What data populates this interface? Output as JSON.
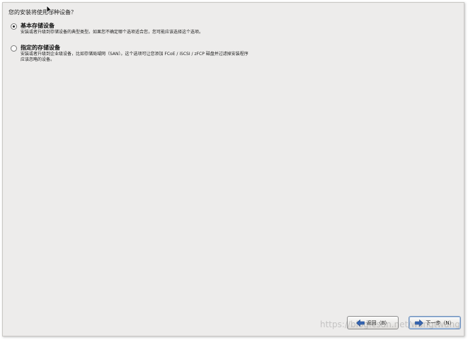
{
  "question": "您的安装将使用哪种设备？",
  "options": [
    {
      "title": "基本存储设备",
      "desc_lines": [
        "安装或者升级到存储设备的典型类型。如果您不确定哪个选项适合您，您可能应该选择这个选项。"
      ],
      "selected": true
    },
    {
      "title": "指定的存储设备",
      "desc_lines": [
        "安装或者升级到企业级设备，比如存储局域网（SAN）。这个选项可让您添加 FCoE / iSCSI / zFCP 磁盘并过滤掉安装程序",
        "应该忽略的设备。"
      ],
      "selected": false
    }
  ],
  "buttons": {
    "back_label": "返回（B）",
    "next_label": "下一步（N）"
  },
  "watermark": "https://blog.csdn.net/wangtwang",
  "colors": {
    "background": "#edeceb",
    "arrow_blue": "#2f64b8"
  }
}
